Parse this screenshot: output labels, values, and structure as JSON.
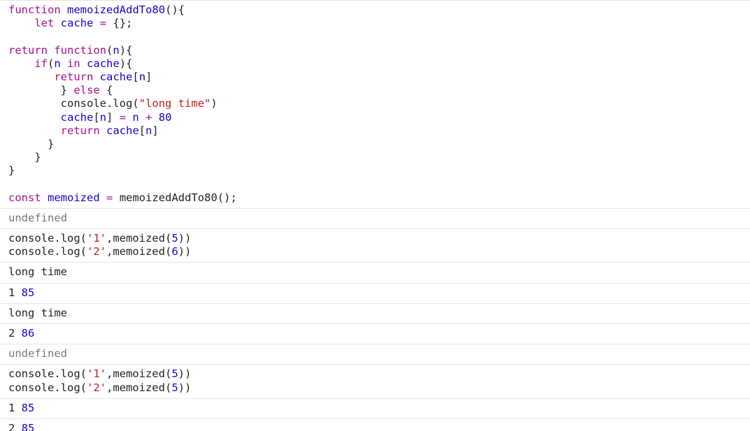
{
  "colors": {
    "keyword": "#aa0d91",
    "identifier": "#1c00cf",
    "string": "#c41a16",
    "number": "#1c00cf",
    "plain": "#222222",
    "undefined": "#777777",
    "divider": "#e6e6e6"
  },
  "entries": [
    {
      "type": "input",
      "lines": [
        [
          [
            "kw",
            "function"
          ],
          [
            "plain",
            " "
          ],
          [
            "def",
            "memoizedAddTo80"
          ],
          [
            "plain",
            "(){"
          ]
        ],
        [
          [
            "plain",
            "    "
          ],
          [
            "kw",
            "let"
          ],
          [
            "plain",
            " "
          ],
          [
            "def",
            "cache"
          ],
          [
            "plain",
            " "
          ],
          [
            "op",
            "="
          ],
          [
            "plain",
            " {};"
          ]
        ],
        [
          [
            "plain",
            ""
          ]
        ],
        [
          [
            "kw",
            "return"
          ],
          [
            "plain",
            " "
          ],
          [
            "kw",
            "function"
          ],
          [
            "plain",
            "("
          ],
          [
            "def",
            "n"
          ],
          [
            "plain",
            "){"
          ]
        ],
        [
          [
            "plain",
            "    "
          ],
          [
            "kw",
            "if"
          ],
          [
            "plain",
            "("
          ],
          [
            "var",
            "n"
          ],
          [
            "plain",
            " "
          ],
          [
            "kw",
            "in"
          ],
          [
            "plain",
            " "
          ],
          [
            "var",
            "cache"
          ],
          [
            "plain",
            "){"
          ]
        ],
        [
          [
            "plain",
            "       "
          ],
          [
            "kw",
            "return"
          ],
          [
            "plain",
            " "
          ],
          [
            "var",
            "cache"
          ],
          [
            "plain",
            "["
          ],
          [
            "var",
            "n"
          ],
          [
            "plain",
            "]"
          ]
        ],
        [
          [
            "plain",
            "        } "
          ],
          [
            "kw",
            "else"
          ],
          [
            "plain",
            " {"
          ]
        ],
        [
          [
            "plain",
            "        console.log("
          ],
          [
            "str",
            "\"long time\""
          ],
          [
            "plain",
            ")"
          ]
        ],
        [
          [
            "plain",
            "        "
          ],
          [
            "var",
            "cache"
          ],
          [
            "plain",
            "["
          ],
          [
            "var",
            "n"
          ],
          [
            "plain",
            "] "
          ],
          [
            "op",
            "="
          ],
          [
            "plain",
            " "
          ],
          [
            "var",
            "n"
          ],
          [
            "plain",
            " "
          ],
          [
            "op",
            "+"
          ],
          [
            "plain",
            " "
          ],
          [
            "num",
            "80"
          ]
        ],
        [
          [
            "plain",
            "        "
          ],
          [
            "kw",
            "return"
          ],
          [
            "plain",
            " "
          ],
          [
            "var",
            "cache"
          ],
          [
            "plain",
            "["
          ],
          [
            "var",
            "n"
          ],
          [
            "plain",
            "]"
          ]
        ],
        [
          [
            "plain",
            "      }"
          ]
        ],
        [
          [
            "plain",
            "    }"
          ]
        ],
        [
          [
            "plain",
            "}"
          ]
        ],
        [
          [
            "plain",
            ""
          ]
        ],
        [
          [
            "kw",
            "const"
          ],
          [
            "plain",
            " "
          ],
          [
            "def",
            "memoized"
          ],
          [
            "plain",
            " "
          ],
          [
            "op",
            "="
          ],
          [
            "plain",
            " memoizedAddTo80();"
          ]
        ]
      ]
    },
    {
      "type": "undefined",
      "text": "undefined"
    },
    {
      "type": "input",
      "lines": [
        [
          [
            "plain",
            "console.log("
          ],
          [
            "str",
            "'1'"
          ],
          [
            "plain",
            ",memoized("
          ],
          [
            "num",
            "5"
          ],
          [
            "plain",
            "))"
          ]
        ],
        [
          [
            "plain",
            "console.log("
          ],
          [
            "str",
            "'2'"
          ],
          [
            "plain",
            ",memoized("
          ],
          [
            "num",
            "6"
          ],
          [
            "plain",
            "))"
          ]
        ]
      ]
    },
    {
      "type": "log",
      "parts": [
        [
          "plain",
          "long time"
        ]
      ]
    },
    {
      "type": "log",
      "parts": [
        [
          "plain",
          "1 "
        ],
        [
          "num",
          "85"
        ]
      ]
    },
    {
      "type": "log",
      "parts": [
        [
          "plain",
          "long time"
        ]
      ]
    },
    {
      "type": "log",
      "parts": [
        [
          "plain",
          "2 "
        ],
        [
          "num",
          "86"
        ]
      ]
    },
    {
      "type": "undefined",
      "text": "undefined"
    },
    {
      "type": "input",
      "lines": [
        [
          [
            "plain",
            "console.log("
          ],
          [
            "str",
            "'1'"
          ],
          [
            "plain",
            ",memoized("
          ],
          [
            "num",
            "5"
          ],
          [
            "plain",
            "))"
          ]
        ],
        [
          [
            "plain",
            "console.log("
          ],
          [
            "str",
            "'2'"
          ],
          [
            "plain",
            ",memoized("
          ],
          [
            "num",
            "5"
          ],
          [
            "plain",
            "))"
          ]
        ]
      ]
    },
    {
      "type": "log",
      "parts": [
        [
          "plain",
          "1 "
        ],
        [
          "num",
          "85"
        ]
      ]
    },
    {
      "type": "log",
      "parts": [
        [
          "plain",
          "2 "
        ],
        [
          "num",
          "85"
        ]
      ]
    }
  ]
}
